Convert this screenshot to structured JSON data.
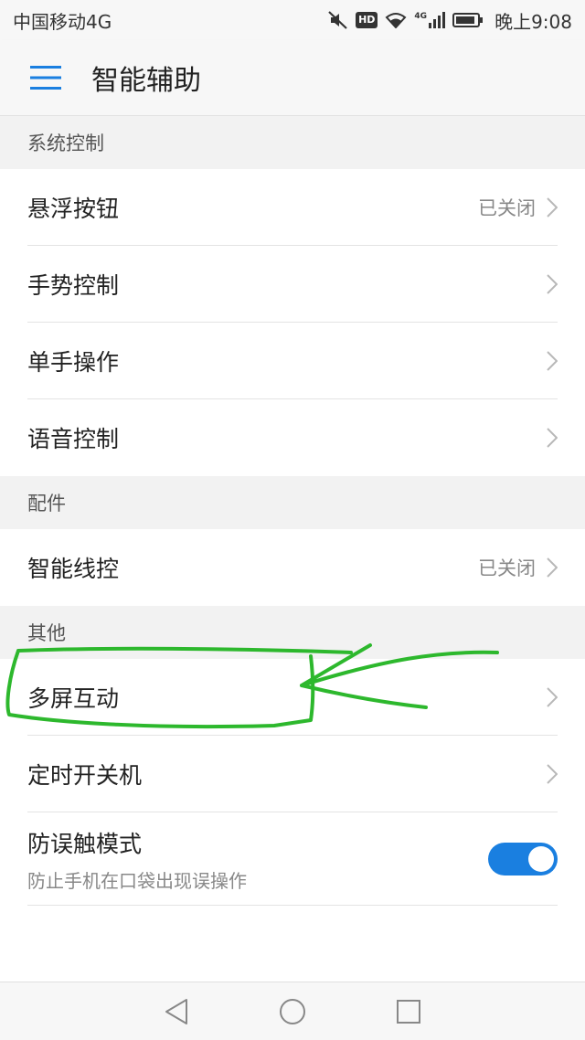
{
  "status_bar": {
    "carrier": "中国移动4G",
    "hd_badge": "HD",
    "network": "4G",
    "time": "晚上9:08",
    "icons": [
      "mute-icon",
      "hd-icon",
      "wifi-icon",
      "signal-icon",
      "battery-icon"
    ]
  },
  "app_bar": {
    "title": "智能辅助",
    "menu_icon": "hamburger-menu-icon"
  },
  "sections": {
    "system": {
      "header": "系统控制",
      "items": [
        {
          "label": "悬浮按钮",
          "value": "已关闭"
        },
        {
          "label": "手势控制"
        },
        {
          "label": "单手操作"
        },
        {
          "label": "语音控制"
        }
      ]
    },
    "accessories": {
      "header": "配件",
      "items": [
        {
          "label": "智能线控",
          "value": "已关闭"
        }
      ]
    },
    "other": {
      "header": "其他",
      "items": [
        {
          "label": "多屏互动"
        },
        {
          "label": "定时开关机"
        },
        {
          "label": "防误触模式",
          "subtitle": "防止手机在口袋出现误操作",
          "toggle_on": true
        }
      ]
    }
  },
  "nav_bar": {
    "icons": [
      "back-triangle-icon",
      "home-circle-icon",
      "recents-square-icon"
    ]
  },
  "colors": {
    "accent": "#1a7fe0",
    "annotation": "#2db82d"
  }
}
